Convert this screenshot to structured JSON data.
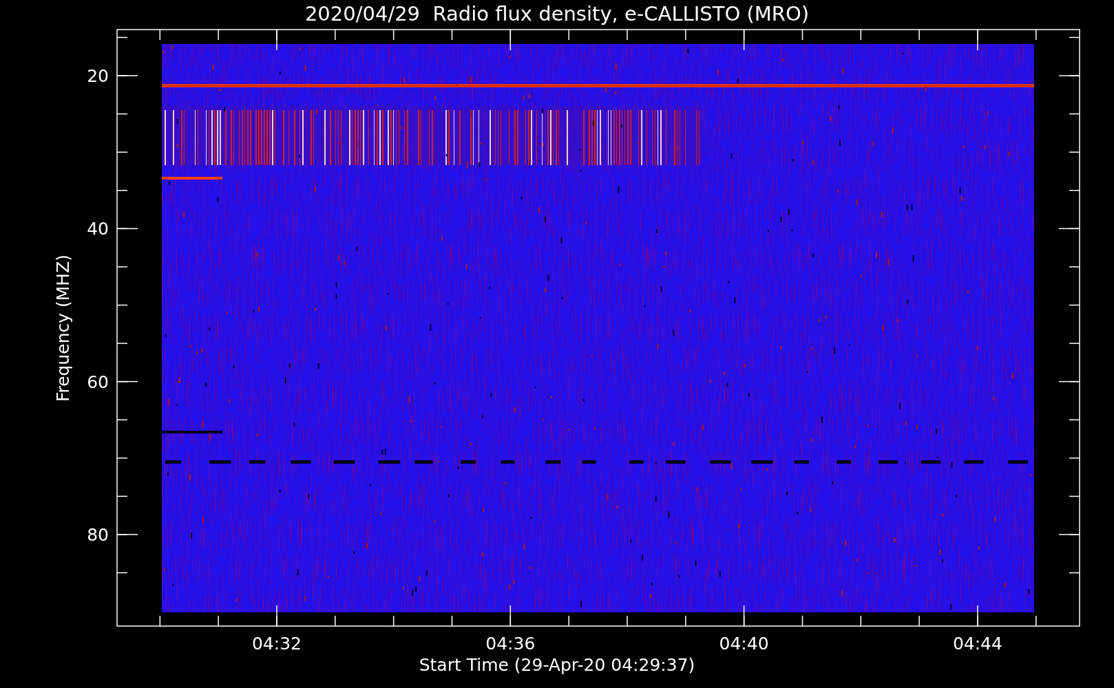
{
  "title": "2020/04/29  Radio flux density, e-CALLISTO (MRO)",
  "y_axis": {
    "label": "Frequency (MHZ)",
    "ticks": [
      "20",
      "40",
      "60",
      "80"
    ]
  },
  "x_axis": {
    "label": "Start Time (29-Apr-20 04:29:37)",
    "ticks": [
      "04:32",
      "04:36",
      "04:40",
      "04:44"
    ]
  }
}
